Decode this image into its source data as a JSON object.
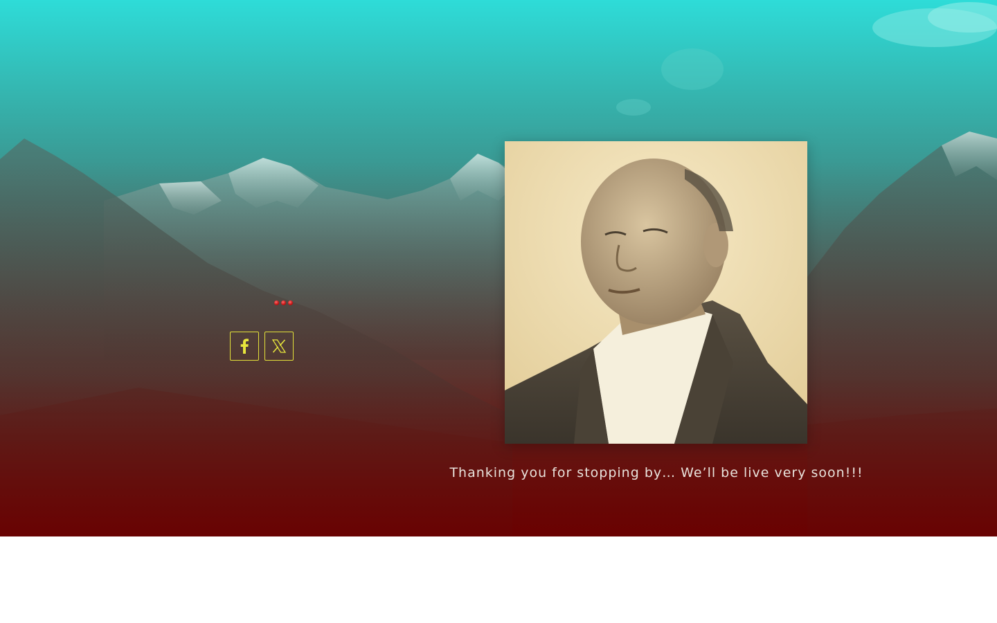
{
  "hero": {
    "background": "mountain-landscape",
    "gradient_top": "#2edcd8",
    "gradient_bottom": "#6b0000"
  },
  "loader": {
    "icon": "loading-dots",
    "color": "#c41414"
  },
  "social": {
    "accent": "#e8e63c",
    "links": [
      {
        "icon": "facebook-icon"
      },
      {
        "icon": "x-twitter-icon"
      }
    ]
  },
  "portrait": {
    "alt": "portrait-photo"
  },
  "message": {
    "text": "Thanking you for stopping by… We’ll be live very soon!!!"
  }
}
